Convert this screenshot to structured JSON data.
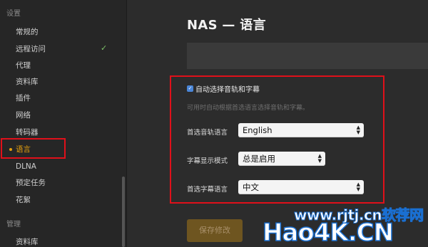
{
  "sidebar": {
    "section_settings": "设置",
    "items": [
      {
        "label": "常规的"
      },
      {
        "label": "远程访问"
      },
      {
        "label": "代理"
      },
      {
        "label": "资料库"
      },
      {
        "label": "插件"
      },
      {
        "label": "网络"
      },
      {
        "label": "转码器"
      },
      {
        "label": "语言"
      },
      {
        "label": "DLNA"
      },
      {
        "label": "预定任务"
      },
      {
        "label": "花絮"
      }
    ],
    "active_index": 7,
    "remote_access_status": "✓",
    "section_manage": "管理",
    "manage_items": [
      {
        "label": "资料库"
      }
    ]
  },
  "main": {
    "title": "NAS — 语言",
    "auto_select_checkbox": {
      "label": "自动选择音轨和字幕",
      "checked": true
    },
    "hint": "可用时自动根据首选语言选择音轨和字幕。",
    "audio_language": {
      "label": "首选音轨语言",
      "value": "English"
    },
    "subtitle_mode": {
      "label": "字幕显示模式",
      "value": "总是启用"
    },
    "subtitle_language": {
      "label": "首选字幕语言",
      "value": "中文"
    },
    "save_button": "保存修改"
  },
  "watermark": {
    "top": "www.rjtj.cn软荐网",
    "bottom": "Hao4K.CN"
  },
  "colors": {
    "accent": "#e5a00d",
    "highlight_box": "#e0101a",
    "checkbox": "#4a86d8"
  }
}
